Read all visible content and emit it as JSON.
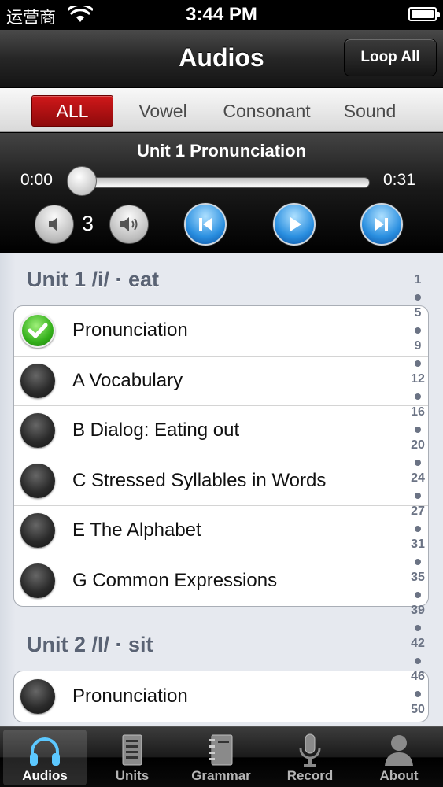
{
  "status_bar": {
    "carrier": "运营商",
    "time": "3:44 PM"
  },
  "nav": {
    "title": "Audios",
    "loop_label": "Loop All"
  },
  "filters": [
    {
      "label": "ALL",
      "active": true
    },
    {
      "label": "Vowel",
      "active": false
    },
    {
      "label": "Consonant",
      "active": false
    },
    {
      "label": "Sound",
      "active": false
    }
  ],
  "player": {
    "track_title": "Unit 1 Pronunciation",
    "elapsed": "0:00",
    "duration": "0:31",
    "progress": 0.0,
    "volume_level": "3"
  },
  "units": [
    {
      "title": "Unit 1 /i/ · eat",
      "items": [
        {
          "label": "Pronunciation",
          "done": true
        },
        {
          "label": "A Vocabulary",
          "done": false
        },
        {
          "label": "B Dialog: Eating out",
          "done": false
        },
        {
          "label": "C Stressed Syllables in Words",
          "done": false
        },
        {
          "label": "E The Alphabet",
          "done": false
        },
        {
          "label": "G Common Expressions",
          "done": false
        }
      ]
    },
    {
      "title": "Unit 2 /I/ · sit",
      "items": [
        {
          "label": "Pronunciation",
          "done": false
        }
      ]
    }
  ],
  "index_numbers": [
    "1",
    "5",
    "9",
    "12",
    "16",
    "20",
    "24",
    "27",
    "31",
    "35",
    "39",
    "42",
    "46",
    "50"
  ],
  "tabs": [
    {
      "label": "Audios",
      "icon": "headphones-icon",
      "active": true
    },
    {
      "label": "Units",
      "icon": "document-icon",
      "active": false
    },
    {
      "label": "Grammar",
      "icon": "notebook-icon",
      "active": false
    },
    {
      "label": "Record",
      "icon": "microphone-icon",
      "active": false
    },
    {
      "label": "About",
      "icon": "person-icon",
      "active": false
    }
  ],
  "colors": {
    "accent_red": "#b31214",
    "control_blue": "#2a8fe0",
    "check_green": "#34b01b"
  }
}
